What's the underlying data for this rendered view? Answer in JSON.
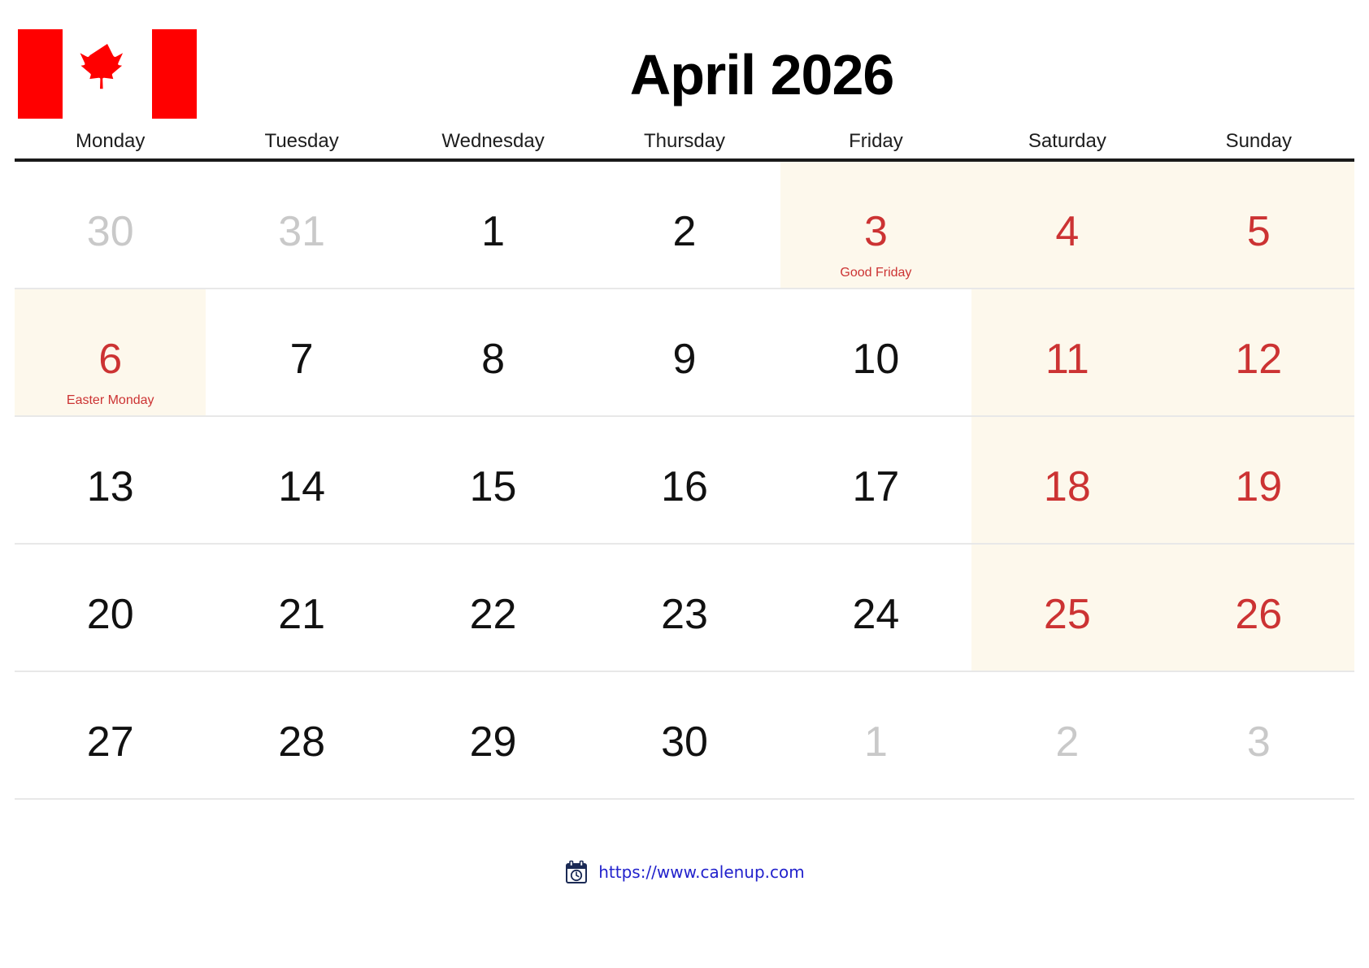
{
  "header": {
    "title": "April 2026",
    "flag_icon": "canada-flag-icon",
    "flag_red": "#FF0000",
    "flag_white": "#FFFFFF"
  },
  "colors": {
    "highlight_bg": "#FDF8EC",
    "holiday_text": "#CC3333",
    "muted_text": "#C9C9C9",
    "normal_text": "#111111",
    "header_rule": "#1A1A1A",
    "row_rule": "#E8E8E8",
    "link": "#2222CC"
  },
  "weekdays": [
    "Monday",
    "Tuesday",
    "Wednesday",
    "Thursday",
    "Friday",
    "Saturday",
    "Sunday"
  ],
  "weeks": [
    [
      {
        "num": "30",
        "muted": true,
        "weekend": false,
        "highlight": false,
        "label": ""
      },
      {
        "num": "31",
        "muted": true,
        "weekend": false,
        "highlight": false,
        "label": ""
      },
      {
        "num": "1",
        "muted": false,
        "weekend": false,
        "highlight": false,
        "label": ""
      },
      {
        "num": "2",
        "muted": false,
        "weekend": false,
        "highlight": false,
        "label": ""
      },
      {
        "num": "3",
        "muted": false,
        "weekend": false,
        "highlight": true,
        "label": "Good Friday",
        "holiday": true
      },
      {
        "num": "4",
        "muted": false,
        "weekend": true,
        "highlight": true,
        "label": ""
      },
      {
        "num": "5",
        "muted": false,
        "weekend": true,
        "highlight": true,
        "label": ""
      }
    ],
    [
      {
        "num": "6",
        "muted": false,
        "weekend": false,
        "highlight": true,
        "label": "Easter Monday",
        "holiday": true
      },
      {
        "num": "7",
        "muted": false,
        "weekend": false,
        "highlight": false,
        "label": ""
      },
      {
        "num": "8",
        "muted": false,
        "weekend": false,
        "highlight": false,
        "label": ""
      },
      {
        "num": "9",
        "muted": false,
        "weekend": false,
        "highlight": false,
        "label": ""
      },
      {
        "num": "10",
        "muted": false,
        "weekend": false,
        "highlight": false,
        "label": ""
      },
      {
        "num": "11",
        "muted": false,
        "weekend": true,
        "highlight": true,
        "label": ""
      },
      {
        "num": "12",
        "muted": false,
        "weekend": true,
        "highlight": true,
        "label": ""
      }
    ],
    [
      {
        "num": "13",
        "muted": false,
        "weekend": false,
        "highlight": false,
        "label": ""
      },
      {
        "num": "14",
        "muted": false,
        "weekend": false,
        "highlight": false,
        "label": ""
      },
      {
        "num": "15",
        "muted": false,
        "weekend": false,
        "highlight": false,
        "label": ""
      },
      {
        "num": "16",
        "muted": false,
        "weekend": false,
        "highlight": false,
        "label": ""
      },
      {
        "num": "17",
        "muted": false,
        "weekend": false,
        "highlight": false,
        "label": ""
      },
      {
        "num": "18",
        "muted": false,
        "weekend": true,
        "highlight": true,
        "label": ""
      },
      {
        "num": "19",
        "muted": false,
        "weekend": true,
        "highlight": true,
        "label": ""
      }
    ],
    [
      {
        "num": "20",
        "muted": false,
        "weekend": false,
        "highlight": false,
        "label": ""
      },
      {
        "num": "21",
        "muted": false,
        "weekend": false,
        "highlight": false,
        "label": ""
      },
      {
        "num": "22",
        "muted": false,
        "weekend": false,
        "highlight": false,
        "label": ""
      },
      {
        "num": "23",
        "muted": false,
        "weekend": false,
        "highlight": false,
        "label": ""
      },
      {
        "num": "24",
        "muted": false,
        "weekend": false,
        "highlight": false,
        "label": ""
      },
      {
        "num": "25",
        "muted": false,
        "weekend": true,
        "highlight": true,
        "label": ""
      },
      {
        "num": "26",
        "muted": false,
        "weekend": true,
        "highlight": true,
        "label": ""
      }
    ],
    [
      {
        "num": "27",
        "muted": false,
        "weekend": false,
        "highlight": false,
        "label": ""
      },
      {
        "num": "28",
        "muted": false,
        "weekend": false,
        "highlight": false,
        "label": ""
      },
      {
        "num": "29",
        "muted": false,
        "weekend": false,
        "highlight": false,
        "label": ""
      },
      {
        "num": "30",
        "muted": false,
        "weekend": false,
        "highlight": false,
        "label": ""
      },
      {
        "num": "1",
        "muted": true,
        "weekend": false,
        "highlight": false,
        "label": ""
      },
      {
        "num": "2",
        "muted": true,
        "weekend": false,
        "highlight": false,
        "label": ""
      },
      {
        "num": "3",
        "muted": true,
        "weekend": false,
        "highlight": false,
        "label": ""
      }
    ]
  ],
  "footer": {
    "icon": "calendar-clock-icon",
    "url": "https://www.calenup.com"
  }
}
